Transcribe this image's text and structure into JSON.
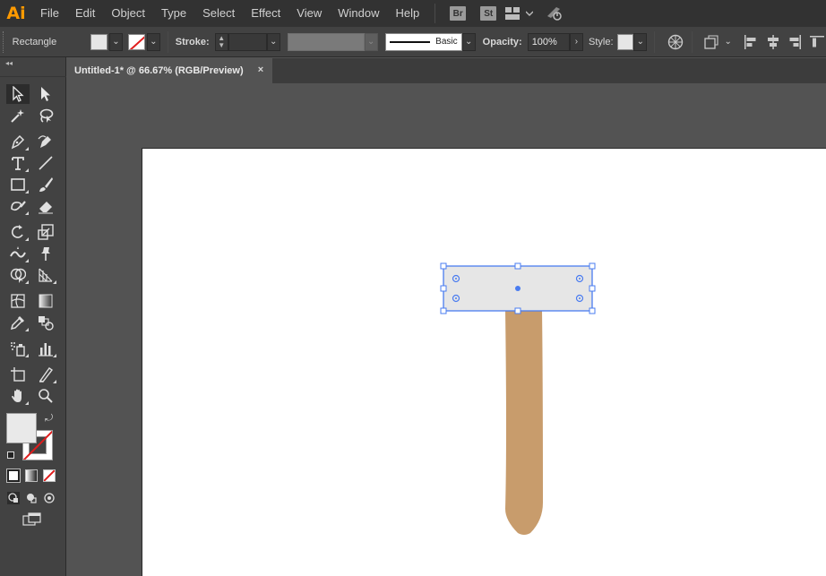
{
  "app": {
    "logo": "Ai"
  },
  "menu": [
    "File",
    "Edit",
    "Object",
    "Type",
    "Select",
    "Effect",
    "View",
    "Window",
    "Help"
  ],
  "menubar_badges": [
    "Br",
    "St"
  ],
  "control_bar": {
    "selection_label": "Rectangle",
    "stroke_label": "Stroke:",
    "brush_label": "Basic",
    "opacity_label": "Opacity:",
    "opacity_value": "100%",
    "style_label": "Style:"
  },
  "document_tab": {
    "title": "Untitled-1* @ 66.67% (RGB/Preview)",
    "close": "×"
  },
  "colors": {
    "fill": "#e6e6e6",
    "handle_fill": "#c89c6c",
    "selection": "#4a7cf0",
    "stroke_none": "#e01d1d",
    "app_accent": "#ff9a00"
  },
  "tools": [
    "selection-tool",
    "direct-selection-tool",
    "magic-wand-tool",
    "lasso-tool",
    "pen-tool",
    "curvature-tool",
    "type-tool",
    "line-segment-tool",
    "rectangle-tool",
    "paintbrush-tool",
    "shaper-tool",
    "eraser-tool",
    "rotate-tool",
    "scale-tool",
    "width-tool",
    "puppet-warp-tool",
    "shape-builder-tool",
    "perspective-grid-tool",
    "mesh-tool",
    "gradient-tool",
    "eyedropper-tool",
    "blend-tool",
    "symbol-sprayer-tool",
    "column-graph-tool",
    "artboard-tool",
    "slice-tool",
    "hand-tool",
    "zoom-tool"
  ]
}
